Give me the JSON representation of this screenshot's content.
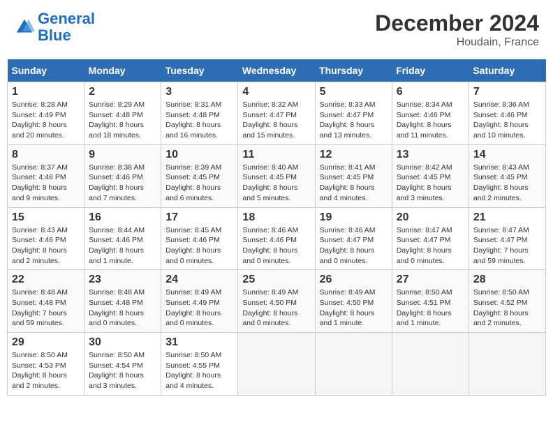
{
  "header": {
    "logo_line1": "General",
    "logo_line2": "Blue",
    "month": "December 2024",
    "location": "Houdain, France"
  },
  "weekdays": [
    "Sunday",
    "Monday",
    "Tuesday",
    "Wednesday",
    "Thursday",
    "Friday",
    "Saturday"
  ],
  "weeks": [
    [
      {
        "day": "1",
        "sunrise": "8:28 AM",
        "sunset": "4:49 PM",
        "daylight": "8 hours and 20 minutes."
      },
      {
        "day": "2",
        "sunrise": "8:29 AM",
        "sunset": "4:48 PM",
        "daylight": "8 hours and 18 minutes."
      },
      {
        "day": "3",
        "sunrise": "8:31 AM",
        "sunset": "4:48 PM",
        "daylight": "8 hours and 16 minutes."
      },
      {
        "day": "4",
        "sunrise": "8:32 AM",
        "sunset": "4:47 PM",
        "daylight": "8 hours and 15 minutes."
      },
      {
        "day": "5",
        "sunrise": "8:33 AM",
        "sunset": "4:47 PM",
        "daylight": "8 hours and 13 minutes."
      },
      {
        "day": "6",
        "sunrise": "8:34 AM",
        "sunset": "4:46 PM",
        "daylight": "8 hours and 11 minutes."
      },
      {
        "day": "7",
        "sunrise": "8:36 AM",
        "sunset": "4:46 PM",
        "daylight": "8 hours and 10 minutes."
      }
    ],
    [
      {
        "day": "8",
        "sunrise": "8:37 AM",
        "sunset": "4:46 PM",
        "daylight": "8 hours and 9 minutes."
      },
      {
        "day": "9",
        "sunrise": "8:38 AM",
        "sunset": "4:46 PM",
        "daylight": "8 hours and 7 minutes."
      },
      {
        "day": "10",
        "sunrise": "8:39 AM",
        "sunset": "4:45 PM",
        "daylight": "8 hours and 6 minutes."
      },
      {
        "day": "11",
        "sunrise": "8:40 AM",
        "sunset": "4:45 PM",
        "daylight": "8 hours and 5 minutes."
      },
      {
        "day": "12",
        "sunrise": "8:41 AM",
        "sunset": "4:45 PM",
        "daylight": "8 hours and 4 minutes."
      },
      {
        "day": "13",
        "sunrise": "8:42 AM",
        "sunset": "4:45 PM",
        "daylight": "8 hours and 3 minutes."
      },
      {
        "day": "14",
        "sunrise": "8:43 AM",
        "sunset": "4:45 PM",
        "daylight": "8 hours and 2 minutes."
      }
    ],
    [
      {
        "day": "15",
        "sunrise": "8:43 AM",
        "sunset": "4:46 PM",
        "daylight": "8 hours and 2 minutes."
      },
      {
        "day": "16",
        "sunrise": "8:44 AM",
        "sunset": "4:46 PM",
        "daylight": "8 hours and 1 minute."
      },
      {
        "day": "17",
        "sunrise": "8:45 AM",
        "sunset": "4:46 PM",
        "daylight": "8 hours and 0 minutes."
      },
      {
        "day": "18",
        "sunrise": "8:46 AM",
        "sunset": "4:46 PM",
        "daylight": "8 hours and 0 minutes."
      },
      {
        "day": "19",
        "sunrise": "8:46 AM",
        "sunset": "4:47 PM",
        "daylight": "8 hours and 0 minutes."
      },
      {
        "day": "20",
        "sunrise": "8:47 AM",
        "sunset": "4:47 PM",
        "daylight": "8 hours and 0 minutes."
      },
      {
        "day": "21",
        "sunrise": "8:47 AM",
        "sunset": "4:47 PM",
        "daylight": "7 hours and 59 minutes."
      }
    ],
    [
      {
        "day": "22",
        "sunrise": "8:48 AM",
        "sunset": "4:48 PM",
        "daylight": "7 hours and 59 minutes."
      },
      {
        "day": "23",
        "sunrise": "8:48 AM",
        "sunset": "4:48 PM",
        "daylight": "8 hours and 0 minutes."
      },
      {
        "day": "24",
        "sunrise": "8:49 AM",
        "sunset": "4:49 PM",
        "daylight": "8 hours and 0 minutes."
      },
      {
        "day": "25",
        "sunrise": "8:49 AM",
        "sunset": "4:50 PM",
        "daylight": "8 hours and 0 minutes."
      },
      {
        "day": "26",
        "sunrise": "8:49 AM",
        "sunset": "4:50 PM",
        "daylight": "8 hours and 1 minute."
      },
      {
        "day": "27",
        "sunrise": "8:50 AM",
        "sunset": "4:51 PM",
        "daylight": "8 hours and 1 minute."
      },
      {
        "day": "28",
        "sunrise": "8:50 AM",
        "sunset": "4:52 PM",
        "daylight": "8 hours and 2 minutes."
      }
    ],
    [
      {
        "day": "29",
        "sunrise": "8:50 AM",
        "sunset": "4:53 PM",
        "daylight": "8 hours and 2 minutes."
      },
      {
        "day": "30",
        "sunrise": "8:50 AM",
        "sunset": "4:54 PM",
        "daylight": "8 hours and 3 minutes."
      },
      {
        "day": "31",
        "sunrise": "8:50 AM",
        "sunset": "4:55 PM",
        "daylight": "8 hours and 4 minutes."
      },
      null,
      null,
      null,
      null
    ]
  ]
}
